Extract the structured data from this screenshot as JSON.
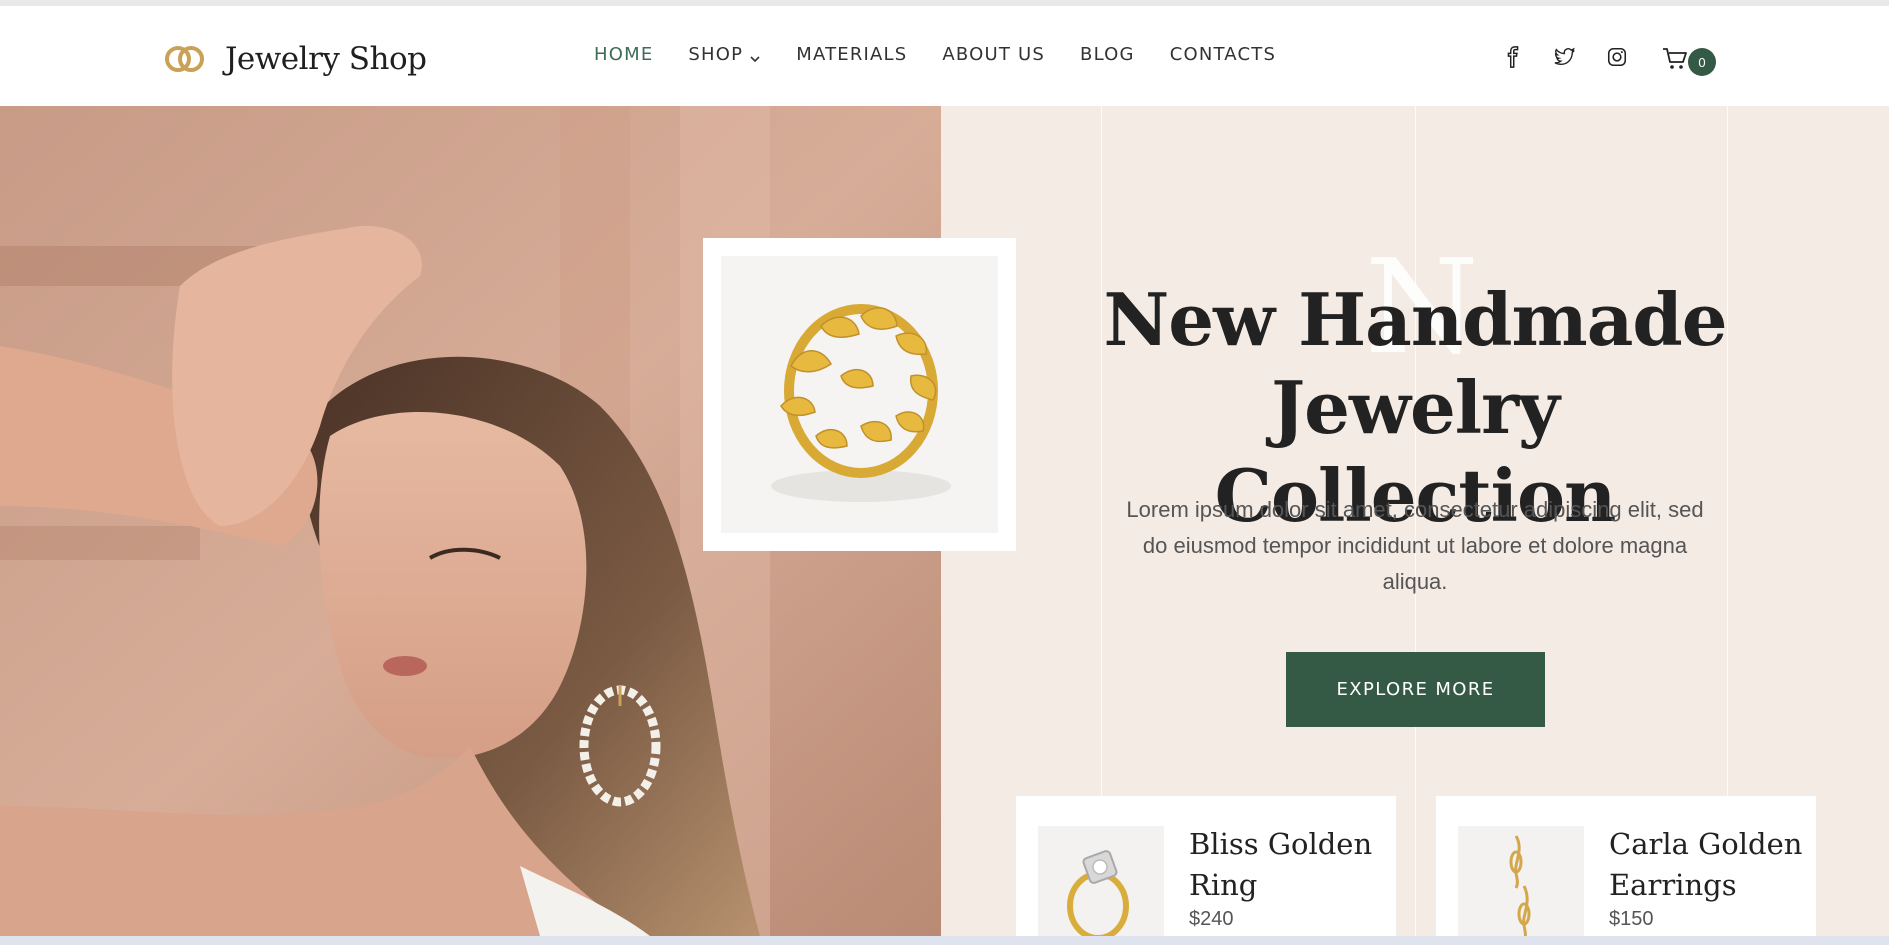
{
  "brand": {
    "name": "Jewelry Shop",
    "logo_icon": "interlocked-rings-logo",
    "accent": "#c9a257"
  },
  "nav": {
    "items": [
      {
        "label": "HOME",
        "active": true
      },
      {
        "label": "SHOP",
        "active": false,
        "has_dropdown": true
      },
      {
        "label": "MATERIALS",
        "active": false
      },
      {
        "label": "ABOUT US",
        "active": false
      },
      {
        "label": "BLOG",
        "active": false
      },
      {
        "label": "CONTACTS",
        "active": false
      }
    ]
  },
  "social": [
    "facebook-icon",
    "twitter-icon",
    "instagram-icon"
  ],
  "cart": {
    "icon": "cart-icon",
    "count": "0"
  },
  "hero": {
    "ghost_letter": "N",
    "headline_line1": "New Handmade",
    "headline_line2": "Jewelry Collection",
    "lead": "Lorem ipsum dolor sit amet, consectetur adipiscing elit, sed do eiusmod tempor incididunt ut labore et dolore magna aliqua.",
    "cta_label": "EXPLORE MORE"
  },
  "products": [
    {
      "name": "Bliss Golden Ring",
      "price": "$240"
    },
    {
      "name": "Carla Golden Earrings",
      "price": "$150"
    }
  ],
  "colors": {
    "primary_green": "#345a45",
    "active_nav": "#3f6b57",
    "hero_bg": "#f4ebe5",
    "gold": "#d9ad3c"
  }
}
